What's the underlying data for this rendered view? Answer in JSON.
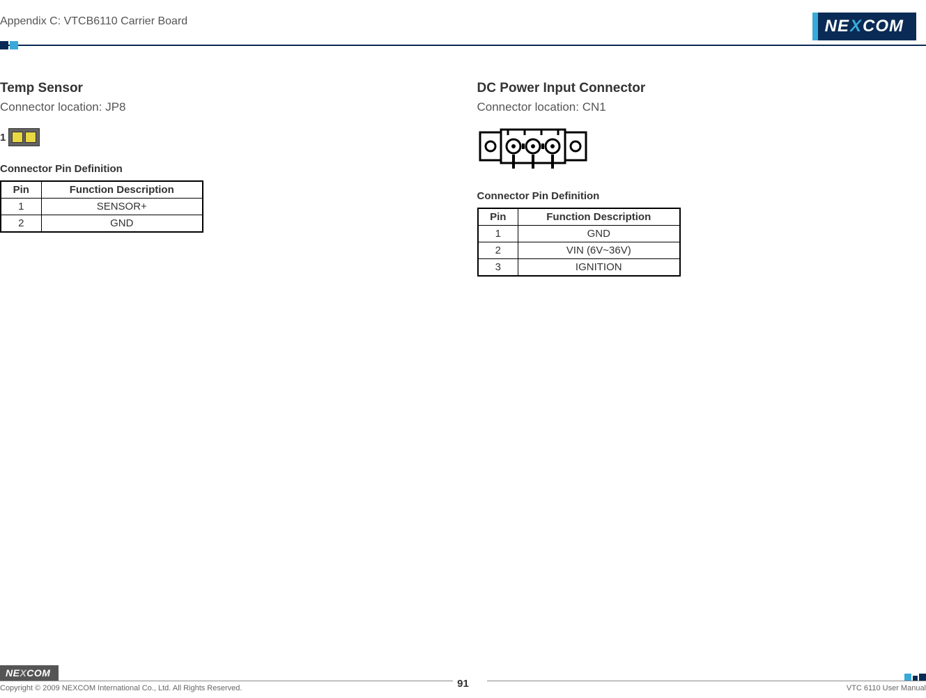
{
  "header": {
    "appendix": "Appendix C: VTCB6110 Carrier Board",
    "brand_pre": "NE",
    "brand_x": "X",
    "brand_post": "COM"
  },
  "left": {
    "title": "Temp Sensor",
    "subtitle": "Connector location: JP8",
    "pin_label": "1",
    "table_title": "Connector Pin Definition",
    "headers": {
      "pin": "Pin",
      "func": "Function Description"
    },
    "rows": [
      {
        "pin": "1",
        "func": "SENSOR+"
      },
      {
        "pin": "2",
        "func": "GND"
      }
    ]
  },
  "right": {
    "title": "DC Power Input Connector",
    "subtitle": "Connector location: CN1",
    "table_title": "Connector Pin Definition",
    "headers": {
      "pin": "Pin",
      "func": "Function Description"
    },
    "rows": [
      {
        "pin": "1",
        "func": "GND"
      },
      {
        "pin": "2",
        "func": "VIN (6V~36V)"
      },
      {
        "pin": "3",
        "func": "IGNITION"
      }
    ]
  },
  "footer": {
    "brand_pre": "NE",
    "brand_x": "X",
    "brand_post": "COM",
    "copyright": "Copyright © 2009 NEXCOM International Co., Ltd. All Rights Reserved.",
    "page": "91",
    "manual": "VTC 6110 User Manual"
  }
}
